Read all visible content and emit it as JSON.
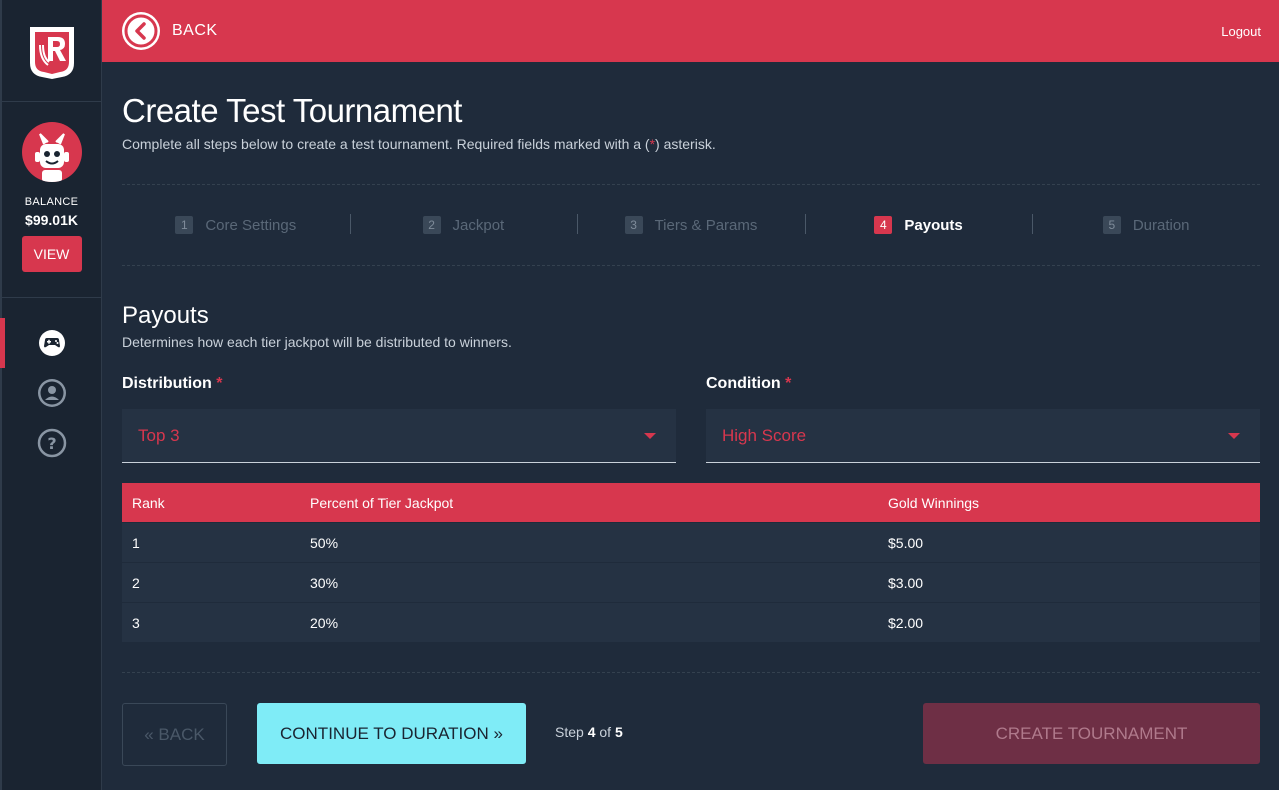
{
  "header": {
    "back_label": "BACK",
    "logout_label": "Logout"
  },
  "sidebar": {
    "balance_label": "BALANCE",
    "balance_value": "$99.01K",
    "view_label": "VIEW",
    "nav": [
      "gamepad-icon",
      "user-icon",
      "help-icon"
    ]
  },
  "page": {
    "title": "Create Test Tournament",
    "subtitle_before": "Complete all steps below to create a test tournament. Required fields marked with a (",
    "subtitle_ast": "*",
    "subtitle_after": ") asterisk."
  },
  "steps": [
    {
      "num": "1",
      "label": "Core Settings"
    },
    {
      "num": "2",
      "label": "Jackpot"
    },
    {
      "num": "3",
      "label": "Tiers & Params"
    },
    {
      "num": "4",
      "label": "Payouts"
    },
    {
      "num": "5",
      "label": "Duration"
    }
  ],
  "section": {
    "title": "Payouts",
    "subtitle": "Determines how each tier jackpot will be distributed to winners."
  },
  "distribution": {
    "label": "Distribution",
    "required": "*",
    "value": "Top 3"
  },
  "condition": {
    "label": "Condition",
    "required": "*",
    "value": "High Score"
  },
  "table": {
    "headers": [
      "Rank",
      "Percent of Tier Jackpot",
      "Gold Winnings"
    ],
    "rows": [
      [
        "1",
        "50%",
        "$5.00"
      ],
      [
        "2",
        "30%",
        "$3.00"
      ],
      [
        "3",
        "20%",
        "$2.00"
      ]
    ]
  },
  "footer": {
    "back_label": "« BACK",
    "continue_label": "CONTINUE TO DURATION »",
    "step_prefix": "Step",
    "step_current": "4",
    "step_of": "of",
    "step_total": "5",
    "create_label": "CREATE TOURNAMENT"
  },
  "colors": {
    "accent": "#d7374e",
    "background": "#1f2b3b",
    "continue": "#7fecf7"
  }
}
